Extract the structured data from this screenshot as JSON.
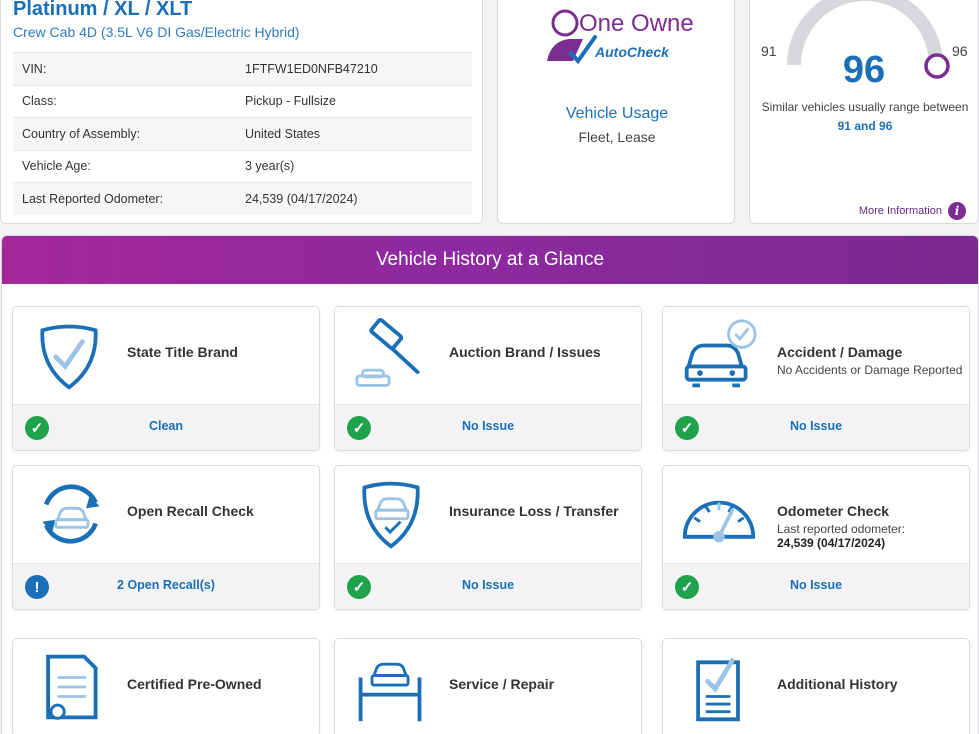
{
  "vehicle": {
    "title": "Platinum / XL / XLT",
    "subtitle": "Crew Cab 4D (3.5L V6 DI Gas/Electric Hybrid)",
    "specs": [
      {
        "label": "VIN:",
        "value": "1FTFW1ED0NFB47210"
      },
      {
        "label": "Class:",
        "value": "Pickup - Fullsize"
      },
      {
        "label": "Country of Assembly:",
        "value": "United States"
      },
      {
        "label": "Vehicle Age:",
        "value": "3 year(s)"
      },
      {
        "label": "Last Reported Odometer:",
        "value": "24,539 (04/17/2024)"
      }
    ]
  },
  "owner": {
    "logo_line1": "One Owner",
    "logo_line2": "AutoCheck",
    "usage_title": "Vehicle Usage",
    "usage_value": "Fleet, Lease"
  },
  "score": {
    "value": "96",
    "range_min": "91",
    "range_max": "96",
    "text_prefix": "Similar vehicles usually range between",
    "text_low": "91",
    "text_and": "and",
    "text_high": "96",
    "more_info": "More Information",
    "accent": "#7b2d91",
    "score_color": "#1a6fb7"
  },
  "glance": {
    "title": "Vehicle History at a Glance",
    "tiles": [
      {
        "icon": "shield-check-icon",
        "title": "State Title Brand",
        "desc": "",
        "status": "Clean",
        "status_type": "ok"
      },
      {
        "icon": "gavel-icon",
        "title": "Auction Brand / Issues",
        "desc": "",
        "status": "No Issue",
        "status_type": "ok"
      },
      {
        "icon": "car-check-icon",
        "title": "Accident / Damage",
        "desc": "No Accidents or Damage Reported",
        "status": "No Issue",
        "status_type": "ok"
      },
      {
        "icon": "car-recall-icon",
        "title": "Open Recall Check",
        "desc": "",
        "status": "2 Open Recall(s)",
        "status_type": "warn"
      },
      {
        "icon": "car-shield-icon",
        "title": "Insurance Loss / Transfer",
        "desc": "",
        "status": "No Issue",
        "status_type": "ok"
      },
      {
        "icon": "speedometer-icon",
        "title": "Odometer Check",
        "desc": "Last reported odometer:",
        "desc_bold": "24,539 (04/17/2024)",
        "status": "No Issue",
        "status_type": "ok"
      },
      {
        "icon": "certificate-icon",
        "title": "Certified Pre-Owned",
        "desc": "",
        "status": "",
        "status_type": ""
      },
      {
        "icon": "car-lift-icon",
        "title": "Service / Repair",
        "desc": "",
        "status": "",
        "status_type": ""
      },
      {
        "icon": "document-check-icon",
        "title": "Additional History",
        "desc": "",
        "status": "",
        "status_type": ""
      }
    ]
  },
  "colors": {
    "brand_blue": "#1a6fb7",
    "purple": "#8e2aa0",
    "ok_green": "#1ea24a"
  }
}
